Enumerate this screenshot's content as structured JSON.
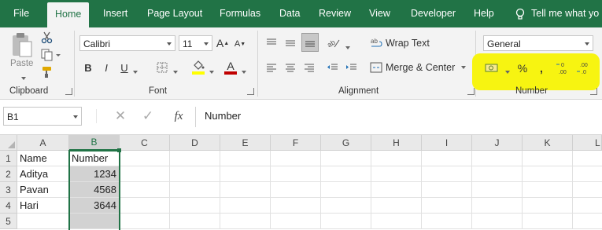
{
  "tabs": [
    "File",
    "Home",
    "Insert",
    "Page Layout",
    "Formulas",
    "Data",
    "Review",
    "View",
    "Developer",
    "Help"
  ],
  "tell_me": "Tell me what yo",
  "clipboard": {
    "paste_label": "Paste",
    "group_label": "Clipboard"
  },
  "font": {
    "name": "Calibri",
    "size": "11",
    "group_label": "Font",
    "bold": "B",
    "italic": "I",
    "underline": "U",
    "font_color": "#c00000",
    "fill_color": "#ffff00"
  },
  "alignment": {
    "wrap_text": "Wrap Text",
    "merge_center": "Merge & Center",
    "group_label": "Alignment"
  },
  "number": {
    "format": "General",
    "group_label": "Number"
  },
  "formula_bar": {
    "name_box": "B1",
    "fx": "fx",
    "content": "Number"
  },
  "grid": {
    "columns": [
      "A",
      "B",
      "C",
      "D",
      "E",
      "F",
      "G",
      "H",
      "I",
      "J",
      "K",
      "L"
    ],
    "rows": [
      "1",
      "2",
      "3",
      "4",
      "5"
    ],
    "data": [
      [
        "Name",
        "Number"
      ],
      [
        "Aditya",
        "1234"
      ],
      [
        "Pavan",
        "4568"
      ],
      [
        "Hari",
        "3644"
      ],
      [
        "",
        ""
      ]
    ]
  },
  "colors": {
    "brand": "#217346",
    "highlight": "#f7f411",
    "selection": "#d2d2d2"
  }
}
